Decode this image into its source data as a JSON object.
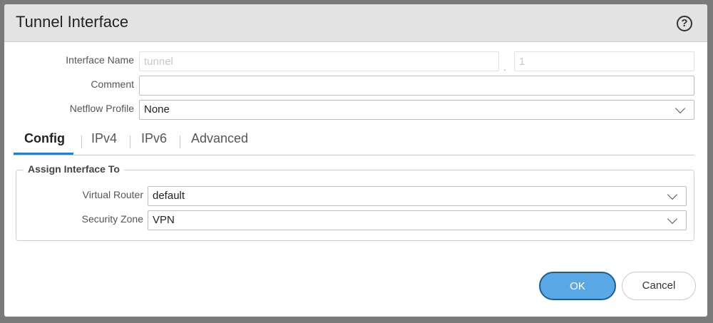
{
  "dialog": {
    "title": "Tunnel Interface",
    "help_icon": "help-circle-icon"
  },
  "form": {
    "interface_name_label": "Interface Name",
    "interface_name_placeholder": "tunnel",
    "interface_name_separator": ".",
    "interface_number_placeholder": "1",
    "comment_label": "Comment",
    "comment_value": "",
    "netflow_label": "Netflow Profile",
    "netflow_value": "None"
  },
  "tabs": [
    {
      "label": "Config",
      "active": true
    },
    {
      "label": "IPv4",
      "active": false
    },
    {
      "label": "IPv6",
      "active": false
    },
    {
      "label": "Advanced",
      "active": false
    }
  ],
  "assign": {
    "legend": "Assign Interface To",
    "virtual_router_label": "Virtual Router",
    "virtual_router_value": "default",
    "security_zone_label": "Security Zone",
    "security_zone_value": "VPN"
  },
  "buttons": {
    "ok_label": "OK",
    "cancel_label": "Cancel"
  },
  "colors": {
    "accent": "#2c7fbf",
    "ok_button": "#5aa9e6"
  }
}
